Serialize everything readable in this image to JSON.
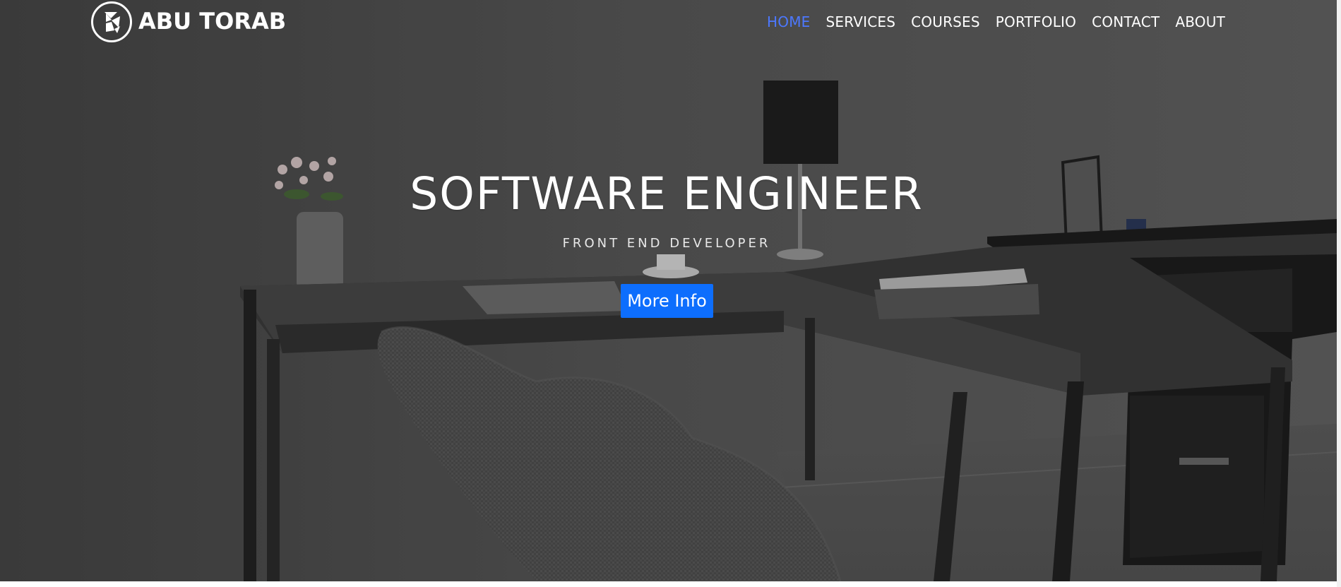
{
  "brand": {
    "name": "ABU TORAB",
    "logo_icon": "hexagon-cube-logo-icon"
  },
  "nav": {
    "items": [
      {
        "label": "HOME",
        "active": true
      },
      {
        "label": "SERVICES",
        "active": false
      },
      {
        "label": "COURSES",
        "active": false
      },
      {
        "label": "PORTFOLIO",
        "active": false
      },
      {
        "label": "CONTACT",
        "active": false
      },
      {
        "label": "ABOUT",
        "active": false
      }
    ],
    "active_color": "#4c78ff"
  },
  "hero": {
    "title": "SOFTWARE ENGINEER",
    "subtitle": "FRONT END DEVELOPER",
    "cta_label": "More Info",
    "cta_color": "#0d6efd"
  }
}
